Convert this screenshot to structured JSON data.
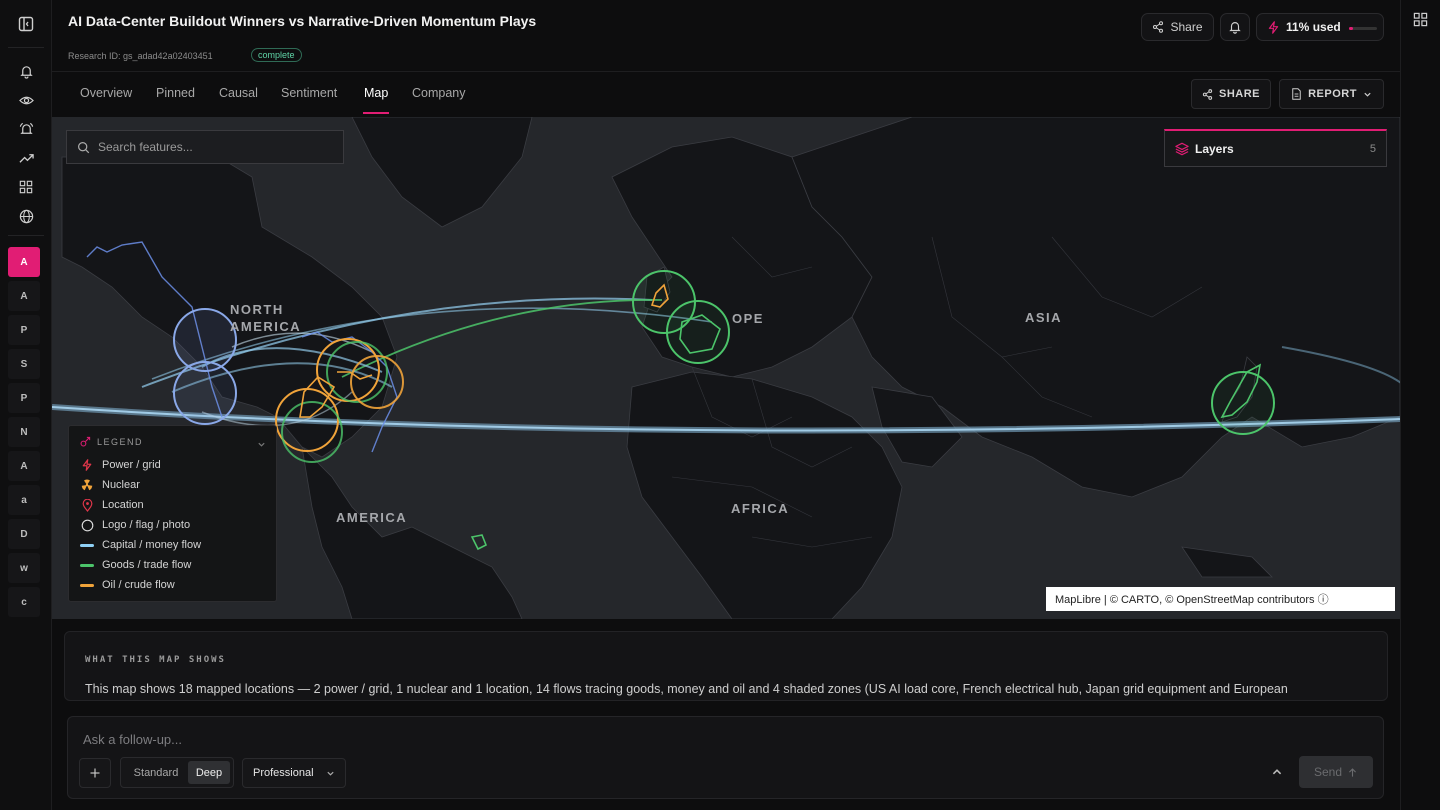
{
  "header": {
    "title": "AI Data-Center Buildout Winners vs Narrative-Driven Momentum Plays",
    "research_id": "Research ID: gs_adad42a02403451",
    "status": "complete",
    "share_label": "Share",
    "usage_label": "11% used",
    "usage_fraction": 0.11
  },
  "rail": {
    "icons": [
      "sidebar-toggle-icon",
      "bell-icon",
      "eye-icon",
      "alert-icon",
      "trend-icon",
      "grid-icon",
      "globe-icon"
    ],
    "chips": [
      "A",
      "A",
      "P",
      "S",
      "P",
      "N",
      "A",
      "a",
      "D",
      "w",
      "c"
    ]
  },
  "tabs": {
    "items": [
      "Overview",
      "Pinned",
      "Causal",
      "Sentiment",
      "Map",
      "Company"
    ],
    "active": "Map",
    "share_label": "SHARE",
    "report_label": "REPORT"
  },
  "map": {
    "search_placeholder": "Search features...",
    "layers_label": "Layers",
    "layers_count": "5",
    "labels": {
      "north_america": "NORTH",
      "north_america_2": "AMERICA",
      "europe": "OPE",
      "asia": "ASIA",
      "africa": "AFRICA",
      "south_america": "AMERICA"
    },
    "attribution": "MapLibre | © CARTO, © OpenStreetMap contributors ⓘ",
    "legend": {
      "title": "LEGEND",
      "items": [
        {
          "label": "Power / grid",
          "icon": "lightning-icon",
          "color": "#e0364a"
        },
        {
          "label": "Nuclear",
          "icon": "radiation-icon",
          "color": "#f0a33a"
        },
        {
          "label": "Location",
          "icon": "pin-icon",
          "color": "#e0364a"
        },
        {
          "label": "Logo / flag / photo",
          "icon": "circle-icon",
          "color": "#dddddd"
        },
        {
          "label": "Capital / money flow",
          "icon": "line-icon",
          "color": "#8fd0f5"
        },
        {
          "label": "Goods / trade flow",
          "icon": "line-icon",
          "color": "#4cc46a"
        },
        {
          "label": "Oil / crude flow",
          "icon": "line-icon",
          "color": "#f0a33a"
        }
      ]
    }
  },
  "explain": {
    "heading": "WHAT THIS MAP SHOWS",
    "body": "This map shows 18 mapped locations — 2 power / grid, 1 nuclear and 1 location, 14 flows tracing goods, money and oil and 4 shaded zones (US AI load core, French electrical hub, Japan grid equipment and European"
  },
  "composer": {
    "placeholder": "Ask a follow-up...",
    "mode_standard": "Standard",
    "mode_deep": "Deep",
    "mode_active": "Deep",
    "tone": "Professional",
    "send_label": "Send"
  },
  "colors": {
    "accent": "#e11d74",
    "capital_flow": "#8fd0f5",
    "goods_flow": "#4cc46a",
    "oil_flow": "#f0a33a"
  }
}
